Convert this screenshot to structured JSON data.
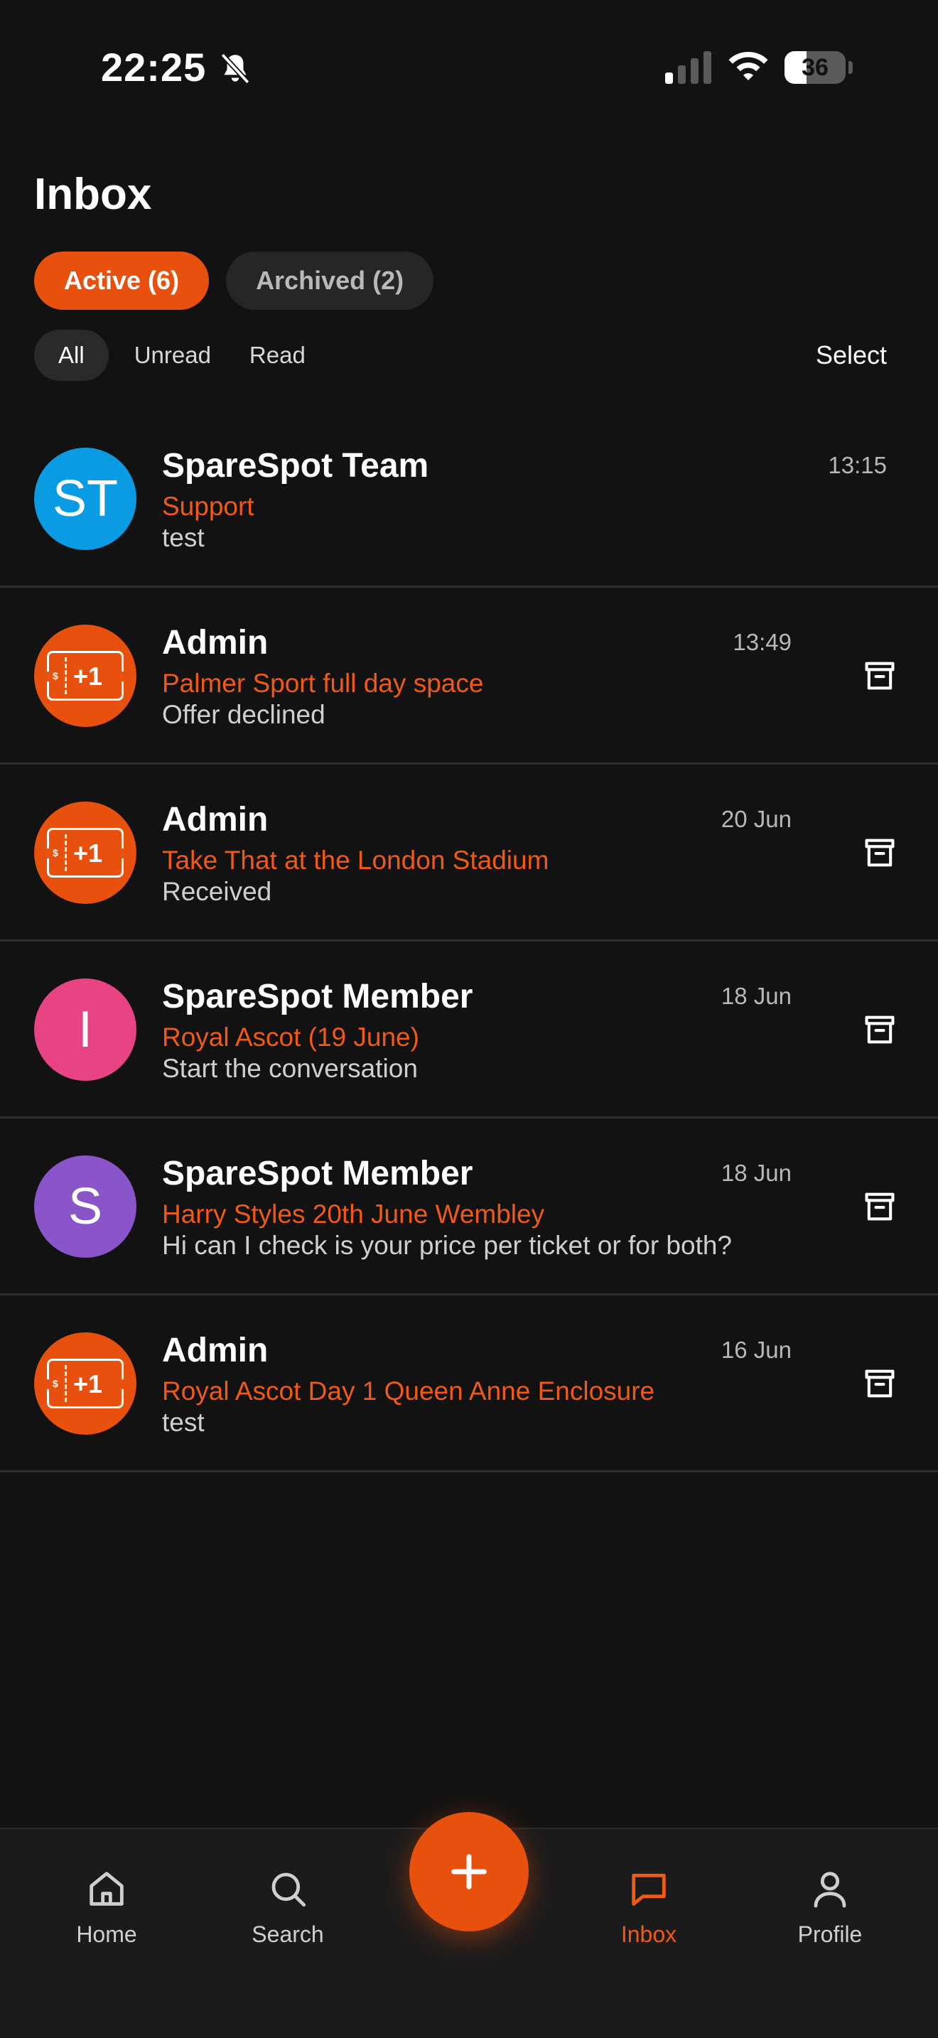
{
  "status_bar": {
    "time": "22:25",
    "battery": "36",
    "battery_level": 0.36,
    "icons": [
      "bell-slash-icon",
      "signal-icon",
      "wifi-icon",
      "battery-icon"
    ]
  },
  "header": {
    "title": "Inbox",
    "tabs": [
      {
        "label": "Active (6)",
        "active": true
      },
      {
        "label": "Archived (2)",
        "active": false
      }
    ],
    "filters": [
      {
        "label": "All",
        "selected": true
      },
      {
        "label": "Unread",
        "selected": false
      },
      {
        "label": "Read",
        "selected": false
      }
    ],
    "select_label": "Select"
  },
  "colors": {
    "accent": "#e8500e",
    "background": "#121212",
    "avatar_blue": "#0b9be3",
    "avatar_pink": "#e84484",
    "avatar_purple": "#8a55c8"
  },
  "conversations": [
    {
      "name": "SpareSpot Team",
      "topic": "Support",
      "preview": "test",
      "time": "13:15",
      "avatar_text": "ST",
      "avatar_kind": "initials",
      "avatar_color": "#0b9be3",
      "archivable": false
    },
    {
      "name": "Admin",
      "topic": "Palmer Sport full day space",
      "preview": "Offer declined",
      "time": "13:49",
      "avatar_text": "+1",
      "avatar_kind": "ticket",
      "avatar_color": "#e8500e",
      "archivable": true
    },
    {
      "name": "Admin",
      "topic": "Take That at the London Stadium",
      "preview": "Received",
      "time": "20 Jun",
      "avatar_text": "+1",
      "avatar_kind": "ticket",
      "avatar_color": "#e8500e",
      "archivable": true
    },
    {
      "name": "SpareSpot Member",
      "topic": "Royal Ascot (19 June)",
      "preview": "Start the conversation",
      "time": "18 Jun",
      "avatar_text": "I",
      "avatar_kind": "initials",
      "avatar_color": "#e84484",
      "archivable": true
    },
    {
      "name": "SpareSpot Member",
      "topic": "Harry Styles 20th June Wembley",
      "preview": "Hi can I check is your price per ticket or for both?",
      "time": "18 Jun",
      "avatar_text": "S",
      "avatar_kind": "initials",
      "avatar_color": "#8a55c8",
      "archivable": true
    },
    {
      "name": "Admin",
      "topic": "Royal Ascot Day 1 Queen Anne Enclosure",
      "preview": "test",
      "time": "16 Jun",
      "avatar_text": "+1",
      "avatar_kind": "ticket",
      "avatar_color": "#e8500e",
      "archivable": true
    }
  ],
  "ticket_mark": "$",
  "bottom_nav": {
    "items": [
      {
        "label": "Home",
        "icon": "home-icon",
        "active": false
      },
      {
        "label": "Search",
        "icon": "search-icon",
        "active": false
      },
      {
        "label": "Inbox",
        "icon": "chat-icon",
        "active": true
      },
      {
        "label": "Profile",
        "icon": "profile-icon",
        "active": false
      }
    ],
    "fab_icon": "plus-icon"
  }
}
